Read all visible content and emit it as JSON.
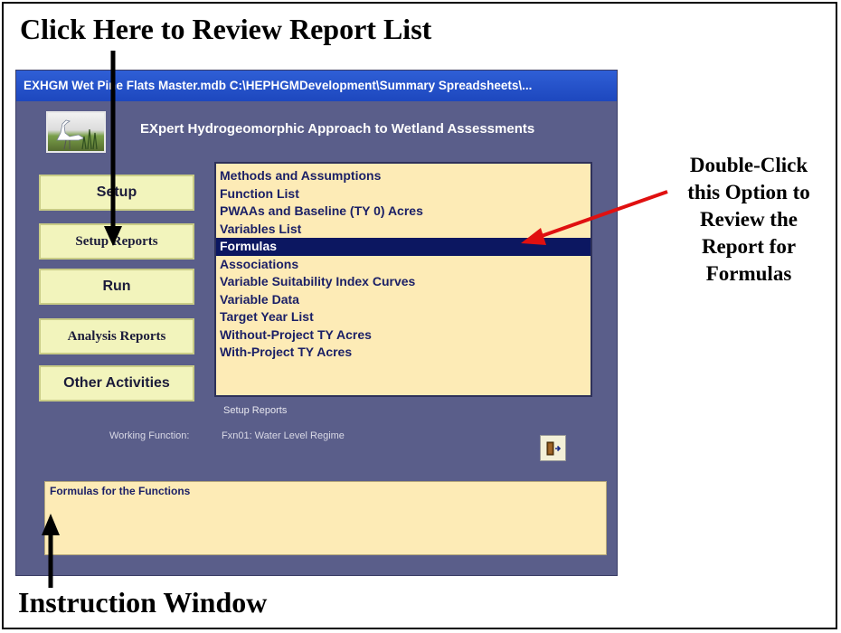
{
  "annotations": {
    "top": "Click Here to Review Report List",
    "right_lines": [
      "Double-Click",
      "this Option to",
      "Review the",
      "Report for",
      "Formulas"
    ],
    "bottom": "Instruction Window"
  },
  "window": {
    "title": "EXHGM    Wet Pine Flats Master.mdb    C:\\HEPHGMDevelopment\\Summary Spreadsheets\\...",
    "app_title": "EXpert Hydrogeomorphic Approach to Wetland Assessments"
  },
  "buttons": {
    "setup": "Setup",
    "setup_reports": "Setup Reports",
    "run": "Run",
    "analysis_reports": "Analysis Reports",
    "other_activities": "Other Activities"
  },
  "report_list": {
    "items": [
      "Methods and Assumptions",
      "Function List",
      "PWAAs and Baseline (TY 0) Acres",
      "Variables List",
      "Formulas",
      "Associations",
      "Variable Suitability Index Curves",
      "Variable Data",
      "Target Year List",
      "Without-Project TY Acres",
      "With-Project TY Acres"
    ],
    "selected": "Formulas",
    "caption": "Setup Reports"
  },
  "working_function": {
    "label": "Working Function:",
    "value": "Fxn01:  Water Level Regime"
  },
  "instruction_text": "Formulas for the Functions",
  "colors": {
    "window_bg": "#5a5e8a",
    "titlebar": "#1d47be",
    "button_bg": "#f2f4bc",
    "list_bg": "#fdebb6",
    "selection": "#0c1761",
    "arrow_red": "#e01010"
  },
  "icons": {
    "logo": "heron-wetland-logo",
    "exit": "exit-door-icon"
  }
}
